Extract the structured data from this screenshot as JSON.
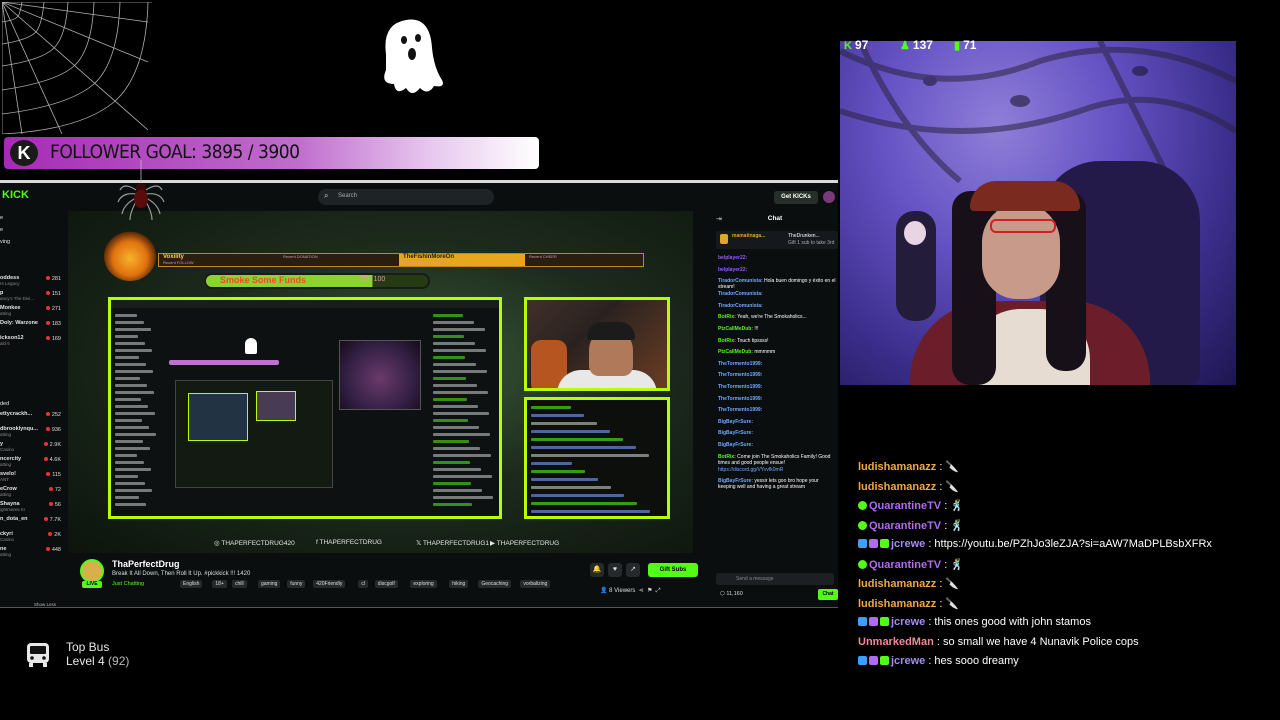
{
  "goal": {
    "badge": "K",
    "text": "FOLLOWER GOAL: 3895 / 3900"
  },
  "browser": {
    "search_placeholder": "Search",
    "get_kicks_label": "Get KICKs",
    "logo": "KICK"
  },
  "sidebar": {
    "nav": [
      "e",
      "e",
      "ving"
    ],
    "followed_header": "",
    "following": [
      {
        "name": "oddess",
        "sub": "rs Legacy",
        "count": "281"
      },
      {
        "name": "p",
        "sub": "ancy's The Divi...",
        "count": "151"
      },
      {
        "name": "Monkee",
        "sub": "atting",
        "count": "271"
      },
      {
        "name": "Doly: Warzone",
        "sub": "",
        "count": "183"
      },
      {
        "name": "ickson12",
        "sub": "ald 6",
        "count": "169"
      }
    ],
    "recommended_header": "ded",
    "recommended": [
      {
        "name": "ettycrackh...",
        "sub": "",
        "count": "252"
      },
      {
        "name": "dbrooklynqu...",
        "sub": "atting",
        "count": "936"
      },
      {
        "name": "y",
        "sub": "Casino",
        "count": "2.9K"
      },
      {
        "name": "ncercity",
        "sub": "atting",
        "count": "4.6K"
      },
      {
        "name": "svelo!",
        "sub": "ANT",
        "count": "115"
      },
      {
        "name": "eCrow",
        "sub": "atting",
        "count": "72"
      },
      {
        "name": "Shayna",
        "sub": "ightmares III",
        "count": "56"
      },
      {
        "name": "n_dota_en",
        "sub": "",
        "count": "7.7K"
      },
      {
        "name": "ckyri",
        "sub": "Casino",
        "count": "2K"
      },
      {
        "name": "ne",
        "sub": "atting",
        "count": "448"
      }
    ],
    "show_less": "Show Less"
  },
  "stream_overlay": {
    "banner": [
      {
        "small": "Recent FOLLOW",
        "big": "Voxility"
      },
      {
        "small": "Recent DONATION",
        "big": ""
      },
      {
        "small": "Recent SUBSCRIBER",
        "big": "TheFishinMoreOn"
      },
      {
        "small": "Recent CHEER",
        "big": ""
      }
    ],
    "progress_label": "Smoke Some Funds",
    "progress_value": "75 / 100",
    "progress_fraction": 0.75,
    "socials": [
      {
        "icon": "instagram-icon",
        "label": "THAPERFECTDRUG420"
      },
      {
        "icon": "facebook-icon",
        "label": "THAPERFECTDRUG"
      },
      {
        "icon": "twitter-icon",
        "label": "THAPERFECTDRUG1"
      },
      {
        "icon": "youtube-icon",
        "label": "THAPERFECTDRUG"
      }
    ]
  },
  "stream_info": {
    "channel": "ThaPerfectDrug",
    "title": "Break It All Down, Then Roll It Up. #pickkick !!! 1420",
    "category": "Just Chatting",
    "tags": [
      "English",
      "18+",
      "chill",
      "gaming",
      "funny",
      "420Friendly",
      "cl",
      "discgolf",
      "exploring",
      "hiking",
      "Geocaching",
      "vorbalizing"
    ],
    "live": "LIVE",
    "gift_subs": "Gift Subs",
    "viewers": "8 Viewers"
  },
  "kick_chat": {
    "header": "Chat",
    "pinned": {
      "user": "mamatinaga...",
      "text": "TheDrunken...",
      "sub": "Gift 1 sub to take 3rd"
    },
    "messages": [
      {
        "user": "belplayer22:",
        "text": "",
        "color": "#9b59ff"
      },
      {
        "user": "belplayer22:",
        "text": "",
        "color": "#9b59ff"
      },
      {
        "user": "TiradorComunista:",
        "text": "Hola buen domingo y éxito en el stream!",
        "color": "#6fa8ff"
      },
      {
        "user": "TiradorComunista:",
        "text": "",
        "color": "#6fa8ff"
      },
      {
        "user": "TiradorComunista:",
        "text": "",
        "color": "#6fa8ff"
      },
      {
        "user": "BotRix:",
        "text": "Yeah, we're The Smokaholics...",
        "color": "#53fc18"
      },
      {
        "user": "PtzCallMeDub:",
        "text": "!!!",
        "color": "#53fc18"
      },
      {
        "user": "BotRix:",
        "text": "Touch tipssss!",
        "color": "#53fc18"
      },
      {
        "user": "PtzCallMeDub:",
        "text": "mmmmm",
        "color": "#53fc18"
      },
      {
        "user": "TheTormento1999:",
        "text": "",
        "color": "#6fa8ff"
      },
      {
        "user": "TheTormento1999:",
        "text": "",
        "color": "#6fa8ff"
      },
      {
        "user": "TheTormento1999:",
        "text": "",
        "color": "#6fa8ff"
      },
      {
        "user": "TheTormento1999:",
        "text": "",
        "color": "#6fa8ff"
      },
      {
        "user": "TheTormento1999:",
        "text": "",
        "color": "#6fa8ff"
      },
      {
        "user": "BigBayFrSure:",
        "text": "",
        "color": "#6fa8ff"
      },
      {
        "user": "BigBayFrSure:",
        "text": "",
        "color": "#6fa8ff"
      },
      {
        "user": "BigBayFrSure:",
        "text": "",
        "color": "#6fa8ff"
      },
      {
        "user": "BotRix:",
        "text": "Come join The Smokaholics Family! Good times and good people ensue!",
        "color": "#53fc18"
      },
      {
        "user": "",
        "text": "https://discord.gg/VYvvfk0mR",
        "color": "#6fa8ff"
      },
      {
        "user": "BigBayFrSure:",
        "text": "yessir lets goo bro hope your keeping well and having a great stream",
        "color": "#6fa8ff"
      }
    ],
    "input_placeholder": "Send a message",
    "kicks": "11,160",
    "chat_button": "Chat"
  },
  "topbus": {
    "title": "Top Bus",
    "level": "Level 4",
    "level_points": "(92)"
  },
  "webcam_stats": [
    {
      "icon": "kick-icon",
      "value": "97",
      "arrow": "↓",
      "color": "#53fc18"
    },
    {
      "icon": "person-icon",
      "value": "137",
      "color": "#53fc18"
    },
    {
      "icon": "bar-chart-icon",
      "value": "71",
      "color": "#53fc18"
    }
  ],
  "overlay_chat": [
    {
      "badges": [],
      "user": "ludishamanazz",
      "color": "#f0a848",
      "text": ": 🔪"
    },
    {
      "badges": [],
      "user": "ludishamanazz",
      "color": "#f0a848",
      "text": ": 🔪"
    },
    {
      "badges": [
        "check"
      ],
      "user": "QuarantineTV",
      "color": "#b06bf0",
      "text": ": 🕺"
    },
    {
      "badges": [
        "check"
      ],
      "user": "QuarantineTV",
      "color": "#b06bf0",
      "text": ": 🕺"
    },
    {
      "badges": [
        "a",
        "b",
        "c"
      ],
      "user": "jcrewe",
      "color": "#a78af0",
      "text": ": https://youtu.be/PZhJo3leZJA?si=aAW7MaDPLBsbXFRx"
    },
    {
      "badges": [
        "check"
      ],
      "user": "QuarantineTV",
      "color": "#b06bf0",
      "text": ": 🕺"
    },
    {
      "badges": [],
      "user": "ludishamanazz",
      "color": "#f0a848",
      "text": ": 🔪"
    },
    {
      "badges": [],
      "user": "ludishamanazz",
      "color": "#f0a848",
      "text": ": 🔪"
    },
    {
      "badges": [
        "a",
        "b",
        "c"
      ],
      "user": "jcrewe",
      "color": "#a78af0",
      "text": ": this ones good with john stamos"
    },
    {
      "badges": [],
      "user": "UnmarkedMan",
      "color": "#f08a9a",
      "text": ": so small we have 4 Nunavik Police cops"
    },
    {
      "badges": [
        "a",
        "b",
        "c"
      ],
      "user": "jcrewe",
      "color": "#a78af0",
      "text": ": hes sooo dreamy"
    }
  ]
}
